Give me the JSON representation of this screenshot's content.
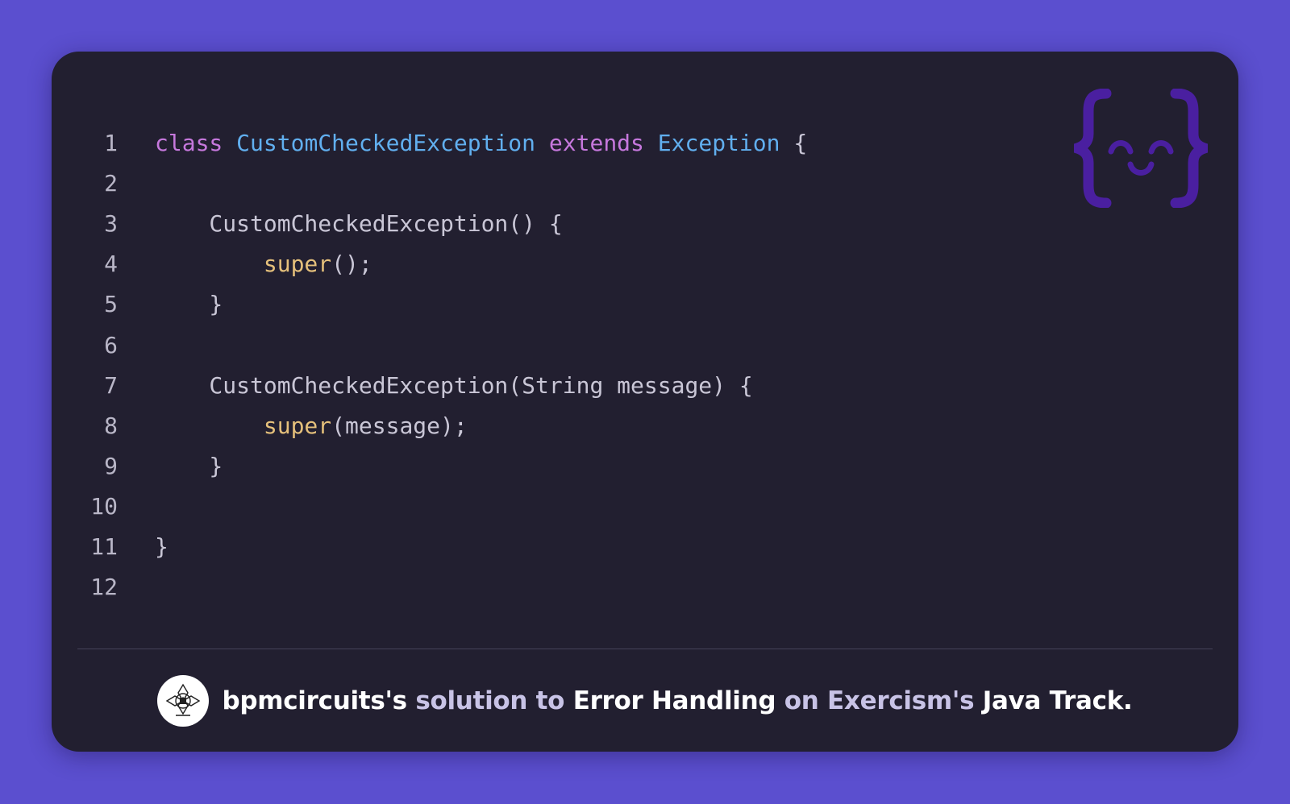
{
  "code": {
    "lines": [
      {
        "number": "1",
        "parts": [
          {
            "text": "class",
            "kind": "kw"
          },
          {
            "text": " ",
            "kind": "pl"
          },
          {
            "text": "CustomCheckedException",
            "kind": "ty"
          },
          {
            "text": " ",
            "kind": "pl"
          },
          {
            "text": "extends",
            "kind": "kw"
          },
          {
            "text": " ",
            "kind": "pl"
          },
          {
            "text": "Exception",
            "kind": "ty"
          },
          {
            "text": " {",
            "kind": "pl"
          }
        ]
      },
      {
        "number": "2",
        "parts": []
      },
      {
        "number": "3",
        "parts": [
          {
            "text": "    CustomCheckedException() {",
            "kind": "pl"
          }
        ]
      },
      {
        "number": "4",
        "parts": [
          {
            "text": "        ",
            "kind": "pl"
          },
          {
            "text": "super",
            "kind": "sp"
          },
          {
            "text": "();",
            "kind": "pl"
          }
        ]
      },
      {
        "number": "5",
        "parts": [
          {
            "text": "    }",
            "kind": "pl"
          }
        ]
      },
      {
        "number": "6",
        "parts": []
      },
      {
        "number": "7",
        "parts": [
          {
            "text": "    CustomCheckedException(String message) {",
            "kind": "pl"
          }
        ]
      },
      {
        "number": "8",
        "parts": [
          {
            "text": "        ",
            "kind": "pl"
          },
          {
            "text": "super",
            "kind": "sp"
          },
          {
            "text": "(message);",
            "kind": "pl"
          }
        ]
      },
      {
        "number": "9",
        "parts": [
          {
            "text": "    }",
            "kind": "pl"
          }
        ]
      },
      {
        "number": "10",
        "parts": []
      },
      {
        "number": "11",
        "parts": [
          {
            "text": "}",
            "kind": "pl"
          }
        ]
      },
      {
        "number": "12",
        "parts": []
      }
    ]
  },
  "footer": {
    "author": "bpmcircuits's",
    "solution_to": "solution to",
    "exercise": "Error Handling",
    "on": "on",
    "site": "Exercism's",
    "track": "Java Track."
  },
  "icons": {
    "logo": "exercism-curly-face-icon",
    "avatar": "bpm-circuits-avatar-icon"
  },
  "colors": {
    "background": "#5b4fcf",
    "card": "#221f30",
    "keyword": "#c678dd",
    "type": "#61afef",
    "super": "#e5c07b",
    "plain": "#c9c6d6",
    "line_number": "#b9b6c7",
    "logo": "#4a1fa0"
  }
}
